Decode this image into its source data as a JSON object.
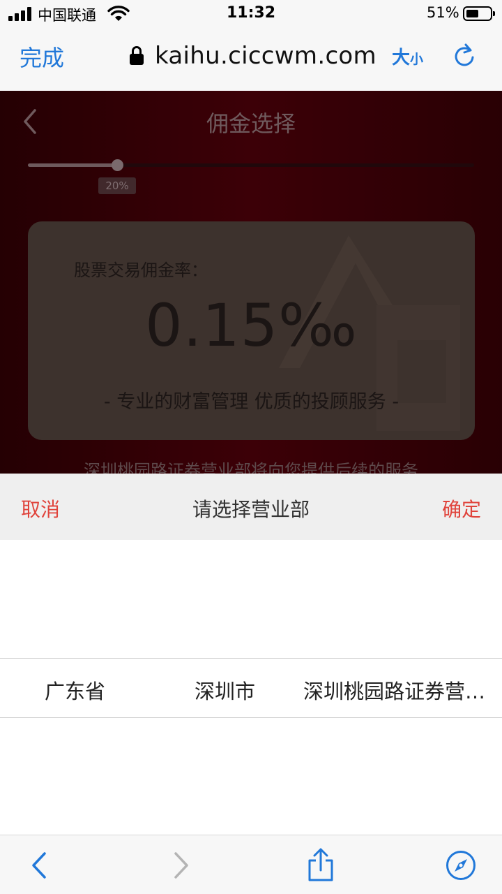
{
  "status_bar": {
    "carrier": "中国联通",
    "time": "11:32",
    "battery": "51%",
    "icons": [
      "signal-icon",
      "wifi-icon",
      "battery-icon"
    ]
  },
  "browser": {
    "done_label": "完成",
    "url": "kaihu.ciccwm.com",
    "text_size_big": "大",
    "text_size_small": "小",
    "accent": "#2178d9"
  },
  "page": {
    "title": "佣金选择",
    "slider": {
      "label": "20%",
      "value": 0.2
    },
    "card": {
      "label": "股票交易佣金率：",
      "rate": "0.15‰",
      "slogan": "- 专业的财富管理 优质的投顾服务 -"
    },
    "note": "深圳桃园路证券营业部将向您提供后续的服务"
  },
  "picker": {
    "cancel_label": "取消",
    "title": "请选择营业部",
    "confirm_label": "确定",
    "action_color": "#e0433b",
    "selected": {
      "province": "广东省",
      "city": "深圳市",
      "branch": "深圳桃园路证券营业部"
    }
  }
}
